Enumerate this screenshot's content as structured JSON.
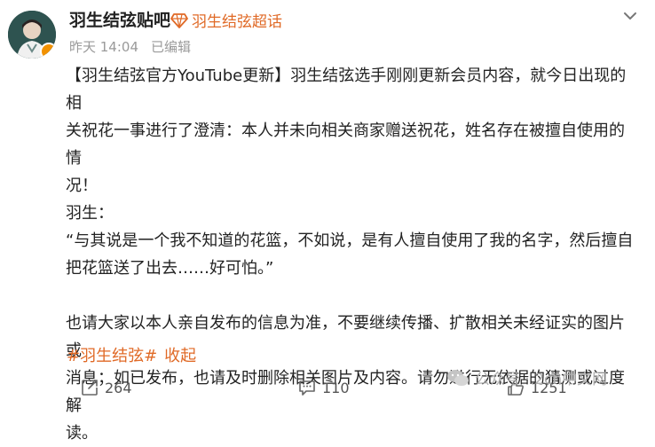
{
  "header": {
    "author": "羽生结弦贴吧",
    "super_topic": "羽生结弦超话",
    "time": "昨天 14:04",
    "edited": "已编辑"
  },
  "post": {
    "lines": [
      "【羽生结弦官方YouTube更新】羽生结弦选手刚刚更新会员内容，就今日出现的相",
      "关祝花一事进行了澄清：本人并未向相关商家赠送祝花，姓名存在被擅自使用的情",
      "况！",
      "羽生：",
      "“与其说是一个我不知道的花篮，不如说，是有人擅自使用了我的名字，然后擅自",
      "把花篮送了出去……好可怕。”",
      "",
      "也请大家以本人亲自发布的信息为准，不要继续传播、扩散相关未经证实的图片或",
      "消息；如已发布，也请及时删除相关图片及内容。请勿进行无依据的猜测或过度解",
      "读。"
    ]
  },
  "tags": {
    "hashtag": "#羽生结弦#",
    "collapse": "收起"
  },
  "actions": {
    "repost_count": "264",
    "comment_count": "110",
    "like_count": "1251"
  },
  "watermark": {
    "text": "公众号 · 2ch中文网"
  },
  "colors": {
    "accent": "#e06a27",
    "meta_gray": "#9a9a9a",
    "verified": "#f29100"
  }
}
